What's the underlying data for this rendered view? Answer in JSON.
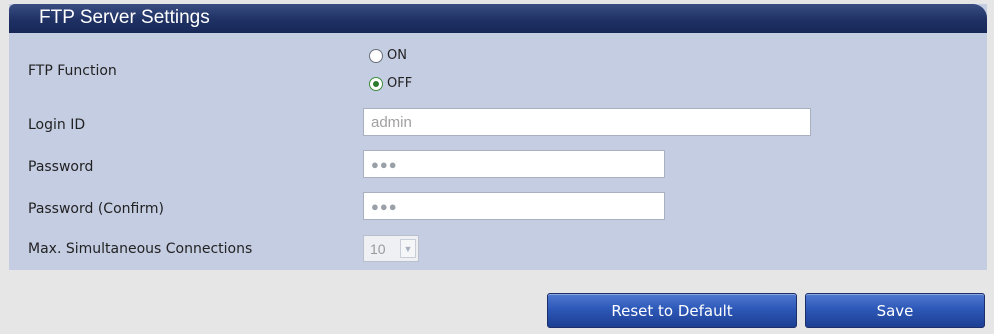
{
  "panel": {
    "title": "FTP Server Settings"
  },
  "ftp_function": {
    "label": "FTP Function",
    "options": [
      {
        "label": "ON",
        "selected": false
      },
      {
        "label": "OFF",
        "selected": true
      }
    ]
  },
  "login_id": {
    "label": "Login ID",
    "value": "admin"
  },
  "password": {
    "label": "Password",
    "value": "●●●"
  },
  "password_confirm": {
    "label": "Password (Confirm)",
    "value": "●●●"
  },
  "max_connections": {
    "label": "Max. Simultaneous Connections",
    "value": "10"
  },
  "buttons": {
    "reset": "Reset to Default",
    "save": "Save"
  },
  "colors": {
    "header": "#1f3164",
    "panel_bg": "#c5cde3",
    "page_bg": "#e6e6e6",
    "button": "#2d58b8"
  }
}
